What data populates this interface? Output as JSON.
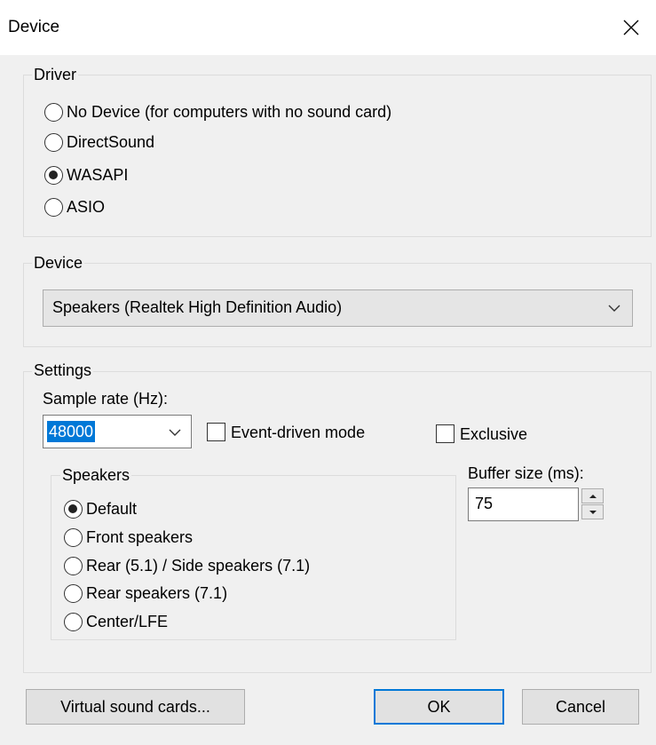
{
  "dialog": {
    "title": "Device",
    "close_icon": "close-icon"
  },
  "driver": {
    "label": "Driver",
    "options": [
      {
        "label": "No Device (for computers with no sound card)",
        "selected": false
      },
      {
        "label": "DirectSound",
        "selected": false
      },
      {
        "label": "WASAPI",
        "selected": true
      },
      {
        "label": "ASIO",
        "selected": false
      }
    ]
  },
  "device": {
    "label": "Device",
    "selected": "Speakers (Realtek High Definition Audio)"
  },
  "settings": {
    "label": "Settings",
    "sample_rate_label": "Sample rate (Hz):",
    "sample_rate_value": "48000",
    "event_driven_label": "Event-driven mode",
    "event_driven_checked": false,
    "exclusive_label": "Exclusive",
    "exclusive_checked": false,
    "buffer_label": "Buffer size (ms):",
    "buffer_value": "75",
    "speakers": {
      "label": "Speakers",
      "options": [
        {
          "label": "Default",
          "selected": true
        },
        {
          "label": "Front speakers",
          "selected": false
        },
        {
          "label": "Rear (5.1) / Side speakers (7.1)",
          "selected": false
        },
        {
          "label": "Rear speakers (7.1)",
          "selected": false
        },
        {
          "label": "Center/LFE",
          "selected": false
        }
      ]
    }
  },
  "buttons": {
    "virtual_sound_cards": "Virtual sound cards...",
    "ok": "OK",
    "cancel": "Cancel"
  },
  "colors": {
    "accent": "#0078d7",
    "background": "#f0f0f0"
  }
}
